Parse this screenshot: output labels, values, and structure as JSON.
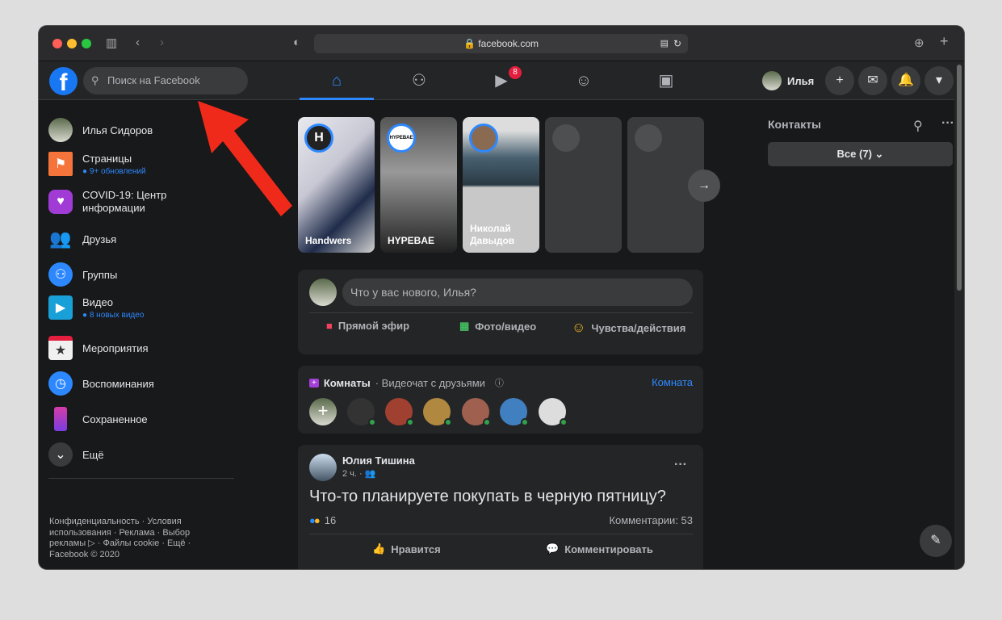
{
  "browser": {
    "url": "facebook.com"
  },
  "header": {
    "search_placeholder": "Поиск на Facebook",
    "watch_badge": "8",
    "profile_name": "Илья"
  },
  "sidebar": {
    "items": [
      {
        "label": "Илья Сидоров"
      },
      {
        "label": "Страницы",
        "sub": "9+ обновлений"
      },
      {
        "label": "COVID-19: Центр информации"
      },
      {
        "label": "Друзья"
      },
      {
        "label": "Группы"
      },
      {
        "label": "Видео",
        "sub": "8 новых видео"
      },
      {
        "label": "Мероприятия"
      },
      {
        "label": "Воспоминания"
      },
      {
        "label": "Сохраненное"
      },
      {
        "label": "Ещё"
      }
    ],
    "footer": "Конфиденциальность · Условия использования · Реклама · Выбор рекламы ▷ · Файлы cookie · Ещё · Facebook © 2020"
  },
  "stories": [
    {
      "name": "Handwers",
      "badge": "H"
    },
    {
      "name": "HYPEBAE",
      "badge": "HYPEBAE"
    },
    {
      "name": "Николай Давыдов"
    }
  ],
  "composer": {
    "placeholder": "Что у вас нового, Илья?",
    "live": "Прямой эфир",
    "photo": "Фото/видео",
    "feeling": "Чувства/действия"
  },
  "rooms": {
    "title": "Комнаты",
    "subtitle": "· Видеочат с друзьями",
    "create": "Комната"
  },
  "post": {
    "author": "Юлия Тишина",
    "time": "2 ч. ·",
    "text": "Что-то планируете покупать в черную пятницу?",
    "reactions": "16",
    "comments": "Комментарии: 53",
    "like": "Нравится",
    "comment": "Комментировать"
  },
  "contacts": {
    "title": "Контакты",
    "filter": "Все (7)"
  }
}
